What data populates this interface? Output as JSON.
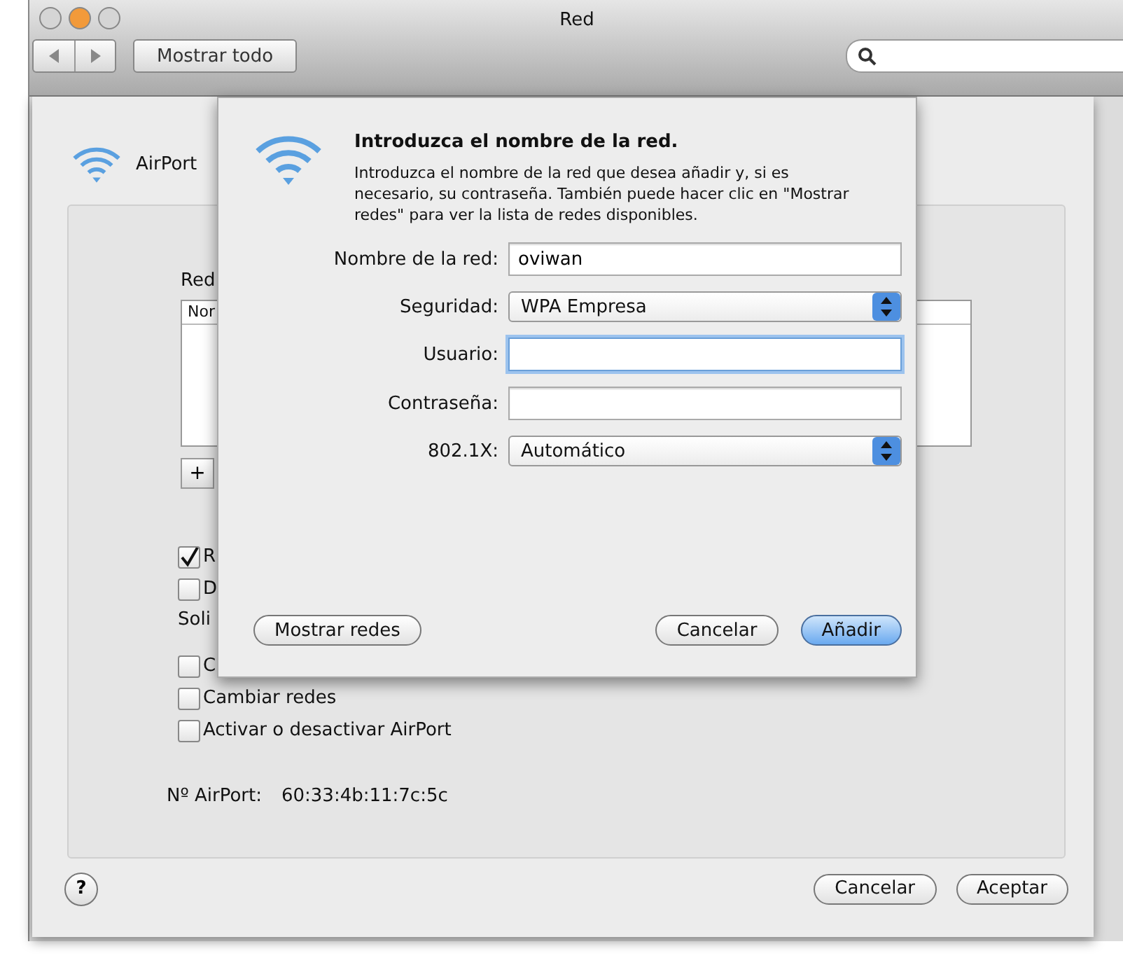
{
  "window": {
    "title": "Red",
    "show_all_button": "Mostrar todo"
  },
  "airport_sheet": {
    "title": "AirPort",
    "networks_label": "Red",
    "table_header": "Nor",
    "add_button": "+",
    "options": [
      {
        "label": "R",
        "checked": true
      },
      {
        "label": "D",
        "checked": false
      }
    ],
    "require_label": "Soli",
    "require_options": [
      {
        "label": "C",
        "checked": false
      },
      {
        "label": "Cambiar redes",
        "checked": false
      },
      {
        "label": "Activar o desactivar AirPort",
        "checked": false
      }
    ],
    "airport_id_label": "Nº AirPort:",
    "airport_id": "60:33:4b:11:7c:5c",
    "help_button": "?",
    "buttons": [
      {
        "label": "Cancelar"
      },
      {
        "label": "Aceptar"
      }
    ]
  },
  "dialog": {
    "title": "Introduzca el nombre de la red.",
    "description": "Introduzca el nombre de la red que desea añadir y, si es necesario, su contraseña. También puede hacer clic en \"Mostrar redes\" para ver la lista de redes disponibles.",
    "fields": [
      {
        "kind": "text",
        "label": "Nombre de la red:",
        "value": "oviwan",
        "focused": false
      },
      {
        "kind": "select",
        "label": "Seguridad:",
        "value": "WPA Empresa"
      },
      {
        "kind": "text",
        "label": "Usuario:",
        "focused": true
      },
      {
        "kind": "text",
        "label": "Contraseña:",
        "focused": false
      },
      {
        "kind": "select",
        "label": "802.1X:",
        "value": "Automático"
      }
    ],
    "left_button": "Mostrar redes",
    "buttons": [
      {
        "label": "Cancelar",
        "default": false
      },
      {
        "label": "Añadir",
        "default": true
      }
    ]
  }
}
